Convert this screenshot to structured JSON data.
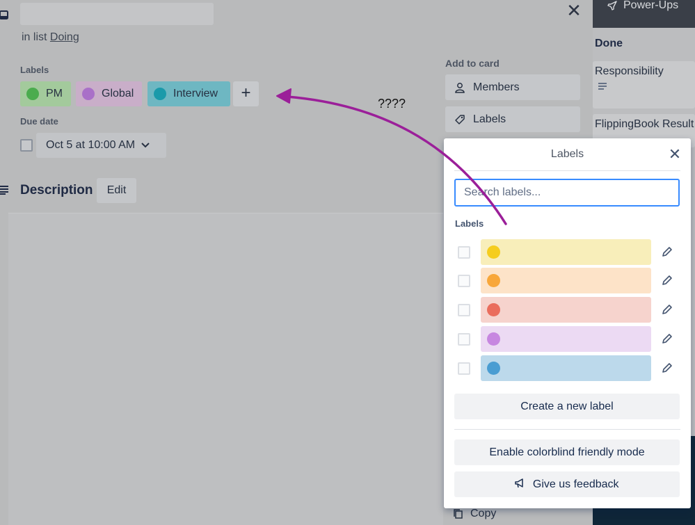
{
  "card": {
    "in_list_prefix": "in list",
    "list_name": "Doing",
    "labels_heading": "Labels",
    "labels": [
      {
        "name": "PM",
        "bg": "#a3ca9c",
        "dot": "#4bac4e"
      },
      {
        "name": "Global",
        "bg": "#c9aec9",
        "dot": "#a970c8"
      },
      {
        "name": "Interview",
        "bg": "#6eb7c2",
        "dot": "#1a9aaa"
      }
    ],
    "add_label_symbol": "+",
    "due_heading": "Due date",
    "due_value": "Oct 5 at 10:00 AM",
    "description_heading": "Description",
    "edit_label": "Edit"
  },
  "sidebar": {
    "heading": "Add to card",
    "members_label": "Members",
    "labels_label": "Labels",
    "copy_label": "Copy"
  },
  "annotation": {
    "text": "????",
    "arrow_color": "#9b1f99"
  },
  "board": {
    "powerups_label": "Power-Ups",
    "list_title": "Done",
    "cards": [
      "Responsibility",
      "FlippingBook Result"
    ]
  },
  "popover": {
    "title": "Labels",
    "search_placeholder": "Search labels...",
    "section_heading": "Labels",
    "label_options": [
      {
        "color": "#f8eeba",
        "dot": "#f5cd1e"
      },
      {
        "color": "#fde3c8",
        "dot": "#f8a73a"
      },
      {
        "color": "#f6d3cd",
        "dot": "#ea6d5d"
      },
      {
        "color": "#ecdaf3",
        "dot": "#c787e0"
      },
      {
        "color": "#bcd9eb",
        "dot": "#4a9dd2"
      }
    ],
    "create_label": "Create a new label",
    "colorblind_label": "Enable colorblind friendly mode",
    "feedback_label": "Give us feedback"
  }
}
